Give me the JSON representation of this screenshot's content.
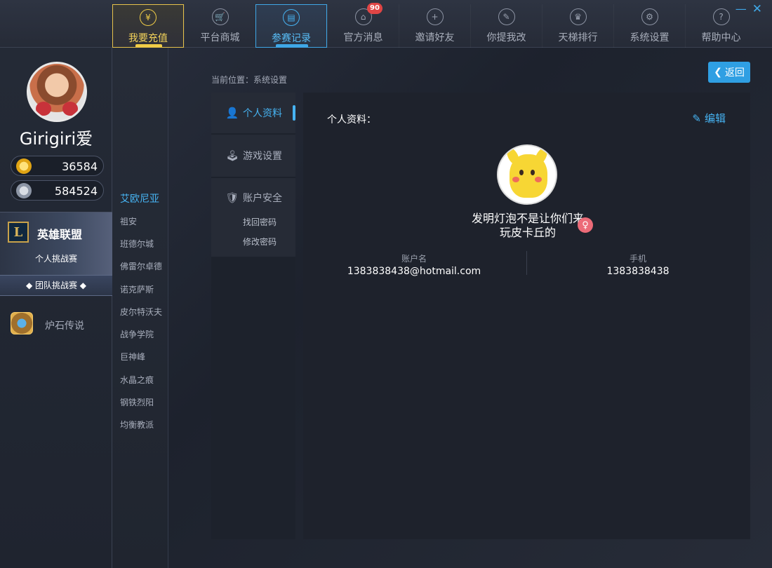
{
  "window": {
    "minimize": "—",
    "close": "✕"
  },
  "nav": {
    "items": [
      {
        "label": "我要充值",
        "icon": "¥"
      },
      {
        "label": "平台商城",
        "icon": "🛒"
      },
      {
        "label": "参赛记录",
        "icon": "▤"
      },
      {
        "label": "官方消息",
        "icon": "⌂",
        "badge": "90"
      },
      {
        "label": "邀请好友",
        "icon": "+"
      },
      {
        "label": "你提我改",
        "icon": "✎"
      },
      {
        "label": "天梯排行",
        "icon": "♛"
      },
      {
        "label": "系统设置",
        "icon": "⚙"
      },
      {
        "label": "帮助中心",
        "icon": "?"
      }
    ],
    "active_index": 2
  },
  "profile": {
    "username": "Girigiri爱",
    "gold": "36584",
    "silver": "584524"
  },
  "games": {
    "lol": {
      "logo": "L",
      "title": "英雄联盟",
      "sub": "个人挑战赛",
      "team": "◆ 团队挑战赛 ◆"
    },
    "hearthstone": {
      "title": "炉石传说"
    }
  },
  "servers": [
    "艾欧尼亚",
    "祖安",
    "班德尔城",
    "佛雷尔卓德",
    "诺克萨斯",
    "皮尔特沃夫",
    "战争学院",
    "巨神峰",
    "水晶之痕",
    "钢铁烈阳",
    "均衡教派"
  ],
  "breadcrumb": "当前位置：系统设置",
  "back_label": "返回",
  "settings_menu": {
    "profile": "个人资料",
    "game": "游戏设置",
    "security": "账户安全",
    "find_password": "找回密码",
    "change_password": "修改密码"
  },
  "panel": {
    "title": "个人资料：",
    "edit": "编辑",
    "signature": "发明灯泡不是让你们来玩皮卡丘的",
    "gender_icon": "♀",
    "account_label": "账户名",
    "account_value": "1383838438@hotmail.com",
    "phone_label": "手机",
    "phone_value": "1383838438"
  },
  "colors": {
    "accent": "#46b3f2",
    "gold": "#f0cc47",
    "badge": "#e04545"
  }
}
